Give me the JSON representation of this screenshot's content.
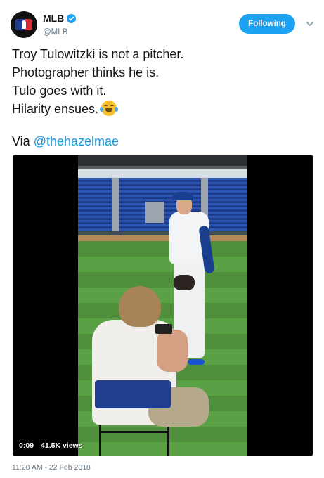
{
  "account": {
    "display_name": "MLB",
    "handle": "@MLB",
    "verified": true,
    "avatar_icon": "mlb-logo-icon"
  },
  "follow_button": {
    "label": "Following"
  },
  "caret_icon": "chevron-down-icon",
  "tweet": {
    "lines": [
      "Troy Tulowitzki is not a pitcher.",
      "Photographer thinks he is.",
      "Tulo goes with it.",
      "Hilarity ensues."
    ],
    "emoji": "face-with-tears-of-joy",
    "via_prefix": "Via ",
    "via_mention": "@thehazelmae"
  },
  "video": {
    "elapsed": "0:09",
    "views": "41.5K views"
  },
  "timestamp": "11:28 AM - 22 Feb 2018",
  "colors": {
    "accent": "#1da1f2",
    "link": "#1b95e0",
    "text": "#14171a",
    "muted": "#657786"
  }
}
